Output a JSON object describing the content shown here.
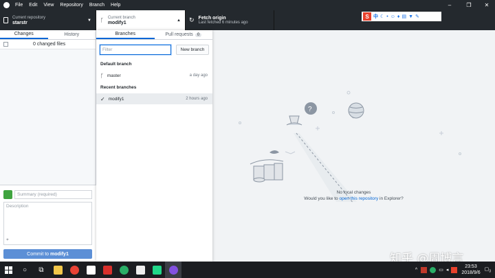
{
  "menu": [
    "File",
    "Edit",
    "View",
    "Repository",
    "Branch",
    "Help"
  ],
  "toolbar": {
    "repo_label": "Current repository",
    "repo_name": "starstr",
    "branch_label": "Current branch",
    "branch_name": "modify1",
    "fetch_label": "Fetch origin",
    "fetch_sub": "Last fetched 6 minutes ago"
  },
  "left": {
    "tab_changes": "Changes",
    "tab_history": "History",
    "changed_files": "0 changed files",
    "summary_placeholder": "Summary (required)",
    "description_placeholder": "Description",
    "coauthor_icon": "+",
    "commit_prefix": "Commit to ",
    "commit_branch": "modify1"
  },
  "dropdown": {
    "tab_branches": "Branches",
    "tab_pulls": "Pull requests",
    "pulls_count": "0",
    "filter_placeholder": "Filter",
    "new_branch": "New branch",
    "default_heading": "Default branch",
    "default_branch": {
      "name": "master",
      "time": "a day ago"
    },
    "recent_heading": "Recent branches",
    "recent_branch": {
      "name": "modify1",
      "time": "2 hours ago"
    }
  },
  "main": {
    "no_changes": "No local changes",
    "prompt_before": "Would you like to ",
    "prompt_link": "open this repository",
    "prompt_after": " in Explorer?"
  },
  "ime": {
    "lang": "中",
    "icons": [
      "moon-icon",
      "dot-icon",
      "emoji-icon",
      "mic-icon",
      "keyboard-icon",
      "shirt-icon",
      "wrench-icon"
    ]
  },
  "taskbar": {
    "time": "23:53",
    "date": "2018/9/6",
    "notifications": "3"
  },
  "watermark": "知乎 @周博言",
  "colors": {
    "dark": "#24292e",
    "accent": "#0366d6",
    "commit_button": "#5c8fd6"
  }
}
